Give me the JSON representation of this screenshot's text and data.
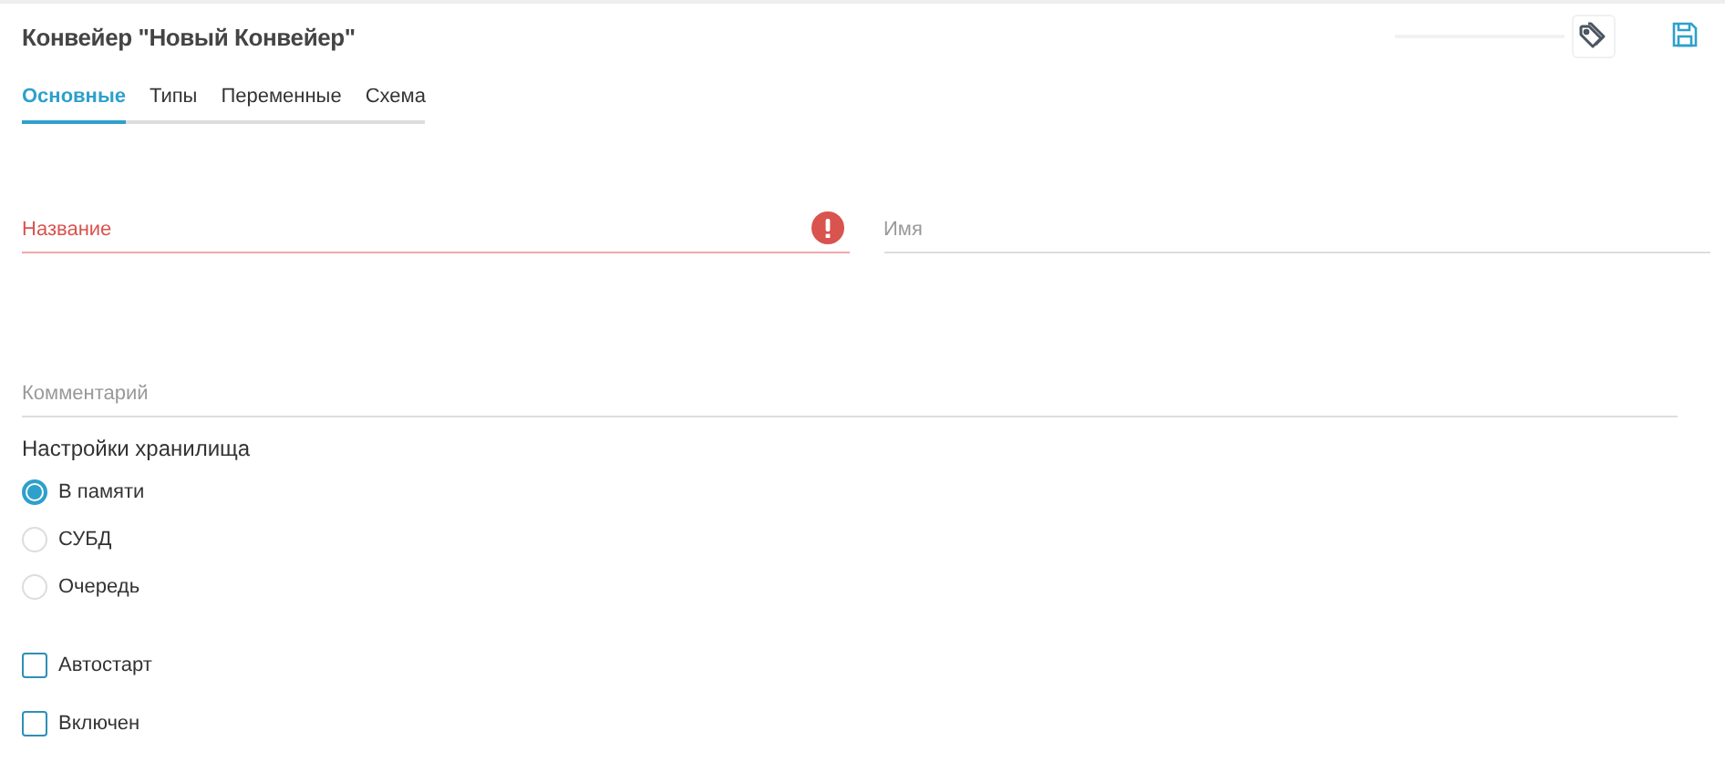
{
  "header": {
    "title": "Конвейер \"Новый Конвейер\""
  },
  "tabs": [
    {
      "label": "Основные",
      "selected": true
    },
    {
      "label": "Типы",
      "selected": false
    },
    {
      "label": "Переменные",
      "selected": false
    },
    {
      "label": "Схема",
      "selected": false
    }
  ],
  "fields": [
    {
      "placeholder": "Название",
      "error": true
    },
    {
      "placeholder": "Имя",
      "error": false
    }
  ],
  "comment": {
    "placeholder": "Комментарий",
    "error": false
  },
  "storage": {
    "label": "Настройки хранилища",
    "options": [
      {
        "label": "В памяти",
        "selected": true
      },
      {
        "label": "СУБД",
        "selected": false
      },
      {
        "label": "Очередь",
        "selected": false
      }
    ]
  },
  "checkboxes": [
    {
      "label": "Автостарт",
      "checked": false
    },
    {
      "label": "Включен",
      "checked": false
    }
  ]
}
